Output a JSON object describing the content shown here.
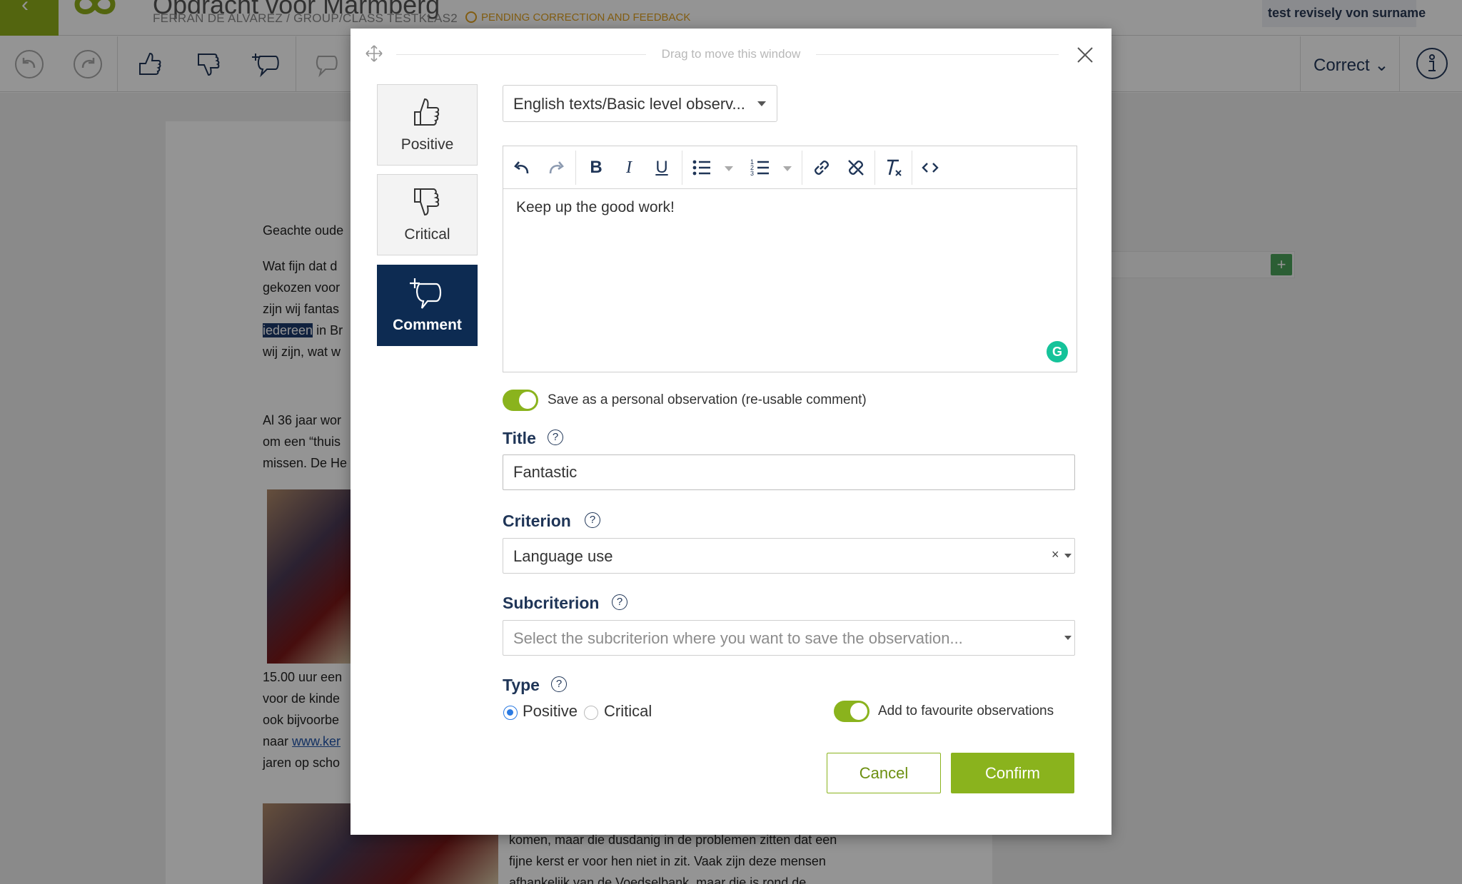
{
  "app": {
    "title": "Opdracht voor Marmberg",
    "subtitle": "FERRAN DE ALVAREZ / GROUP/CLASS TESTKLAS2",
    "status": "PENDING CORRECTION AND FEEDBACK",
    "user_name": "test revisely von surname",
    "correct_menu_label": "Correct"
  },
  "document": {
    "lines": [
      {
        "text": "Geachte oude"
      },
      {
        "text": "Wat fijn dat d"
      },
      {
        "text": "gekozen voor"
      },
      {
        "text": "zijn wij fantas"
      },
      {
        "highlight": "iedereen",
        "text": " in Br"
      },
      {
        "text": "wij zijn, wat w"
      },
      {
        "text": "Al 36 jaar wor"
      },
      {
        "text": "om een “thuis"
      },
      {
        "text": "missen. De He"
      },
      {
        "text": "15.00 uur een"
      },
      {
        "text": "voor de kinde"
      },
      {
        "text": "ook bijvoorbe"
      },
      {
        "text": "naar ",
        "link": "www.ker"
      },
      {
        "text": "jaren op scho"
      },
      {
        "text": "komen, maar die dusdanig in de problemen zitten dat een"
      },
      {
        "text": "fijne kerst er voor hen niet in zit. Vaak zijn deze mensen"
      },
      {
        "text": "afhankelijk van de Voedselbank, maar die is rond de"
      }
    ]
  },
  "modal": {
    "drag_hint": "Drag to move this window",
    "types": [
      {
        "label": "Positive",
        "icon": "thumbs-up-icon",
        "active": false
      },
      {
        "label": "Critical",
        "icon": "thumbs-down-icon",
        "active": false
      },
      {
        "label": "Comment",
        "icon": "comment-add-icon",
        "active": true
      }
    ],
    "observation_set": "English texts/Basic level observ...",
    "editor": {
      "content": "Keep up the good work!",
      "tools": [
        "undo-icon",
        "redo-icon",
        "bold-icon",
        "italic-icon",
        "underline-icon",
        "bullet-list-icon",
        "numbered-list-icon",
        "link-icon",
        "unlink-icon",
        "clear-format-icon",
        "code-icon"
      ]
    },
    "save_personal_label": "Save as a personal observation (re-usable comment)",
    "title_label": "Title",
    "title_value": "Fantastic",
    "criterion_label": "Criterion",
    "criterion_value": "Language use",
    "subcriterion_label": "Subcriterion",
    "subcriterion_placeholder": "Select the subcriterion where you want to save the observation...",
    "type_label": "Type",
    "type_options": [
      {
        "label": "Positive",
        "selected": true
      },
      {
        "label": "Critical",
        "selected": false
      }
    ],
    "favourite_label": "Add to favourite observations",
    "cancel_label": "Cancel",
    "confirm_label": "Confirm"
  },
  "colors": {
    "brand_green": "#8ab31d",
    "navy": "#0d2b52",
    "status_orange": "#e0a020"
  }
}
